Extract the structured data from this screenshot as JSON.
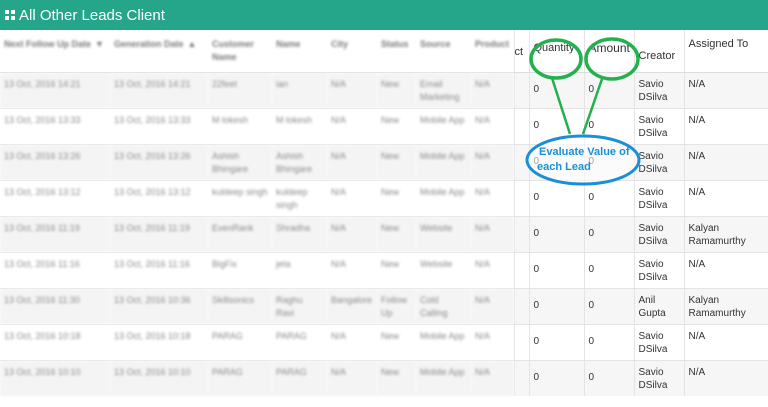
{
  "header": {
    "title": "All Other Leads Client",
    "icon": "table-icon"
  },
  "columns": {
    "next_followup": "Next Follow Up Date",
    "generation_date": "Generation Date",
    "customer_name": "Customer Name",
    "name": "Name",
    "city": "City",
    "status": "Status",
    "source": "Source",
    "product": "Product",
    "product_cut": "ct",
    "quantity": "Quantity",
    "amount": "Amount",
    "creator": "Creator",
    "assigned_to": "Assigned To"
  },
  "rows": [
    {
      "next": "13 Oct, 2016 14:21",
      "gen": "13 Oct, 2016 14:21",
      "customer": "22feet",
      "name": "ian",
      "city": "N/A",
      "status": "New",
      "source": "Email Marketing",
      "product": "N/A",
      "qty": "0",
      "amount": "0",
      "creator": "Savio DSilva",
      "assigned": "N/A"
    },
    {
      "next": "13 Oct, 2016 13:33",
      "gen": "13 Oct, 2016 13:33",
      "customer": "M lokesh",
      "name": "M lokesh",
      "city": "N/A",
      "status": "New",
      "source": "Mobile App",
      "product": "N/A",
      "qty": "0",
      "amount": "0",
      "creator": "Savio DSilva",
      "assigned": "N/A"
    },
    {
      "next": "13 Oct, 2016 13:26",
      "gen": "13 Oct, 2016 13:26",
      "customer": "Ashish Bhingare",
      "name": "Ashish Bhingare",
      "city": "N/A",
      "status": "New",
      "source": "Mobile App",
      "product": "N/A",
      "qty": "0",
      "amount": "0",
      "creator": "Savio DSilva",
      "assigned": "N/A"
    },
    {
      "next": "13 Oct, 2016 13:12",
      "gen": "13 Oct, 2016 13:12",
      "customer": "kuldeep singh",
      "name": "kuldeep singh",
      "city": "N/A",
      "status": "New",
      "source": "Mobile App",
      "product": "N/A",
      "qty": "0",
      "amount": "0",
      "creator": "Savio DSilva",
      "assigned": "N/A"
    },
    {
      "next": "13 Oct, 2016 11:19",
      "gen": "13 Oct, 2016 11:19",
      "customer": "EvenRank",
      "name": "Shradha",
      "city": "N/A",
      "status": "New",
      "source": "Website",
      "product": "N/A",
      "qty": "0",
      "amount": "0",
      "creator": "Savio DSilva",
      "assigned": "Kalyan Ramamurthy"
    },
    {
      "next": "13 Oct, 2016 11:16",
      "gen": "13 Oct, 2016 11:16",
      "customer": "BigFix",
      "name": "jeta",
      "city": "N/A",
      "status": "New",
      "source": "Website",
      "product": "N/A",
      "qty": "0",
      "amount": "0",
      "creator": "Savio DSilva",
      "assigned": "N/A"
    },
    {
      "next": "13 Oct, 2016 11:30",
      "gen": "13 Oct, 2016 10:36",
      "customer": "Skillsonics",
      "name": "Raghu Ravi",
      "city": "Bangalore",
      "status": "Follow Up",
      "source": "Cold Calling",
      "product": "N/A",
      "qty": "0",
      "amount": "0",
      "creator": "Anil Gupta",
      "assigned": "Kalyan Ramamurthy"
    },
    {
      "next": "13 Oct, 2016 10:18",
      "gen": "13 Oct, 2016 10:18",
      "customer": "PARAG",
      "name": "PARAG",
      "city": "N/A",
      "status": "New",
      "source": "Mobile App",
      "product": "N/A",
      "qty": "0",
      "amount": "0",
      "creator": "Savio DSilva",
      "assigned": "N/A"
    },
    {
      "next": "13 Oct, 2016 10:10",
      "gen": "13 Oct, 2016 10:10",
      "customer": "PARAG",
      "name": "PARAG",
      "city": "N/A",
      "status": "New",
      "source": "Mobile App",
      "product": "N/A",
      "qty": "0",
      "amount": "0",
      "creator": "Savio DSilva",
      "assigned": "N/A"
    }
  ],
  "annotation": {
    "text": "Evaluate Value of each Lead",
    "color": "#1a8fd6",
    "highlight_color": "#22b14c"
  },
  "colors": {
    "header_bg": "#25a58a"
  }
}
